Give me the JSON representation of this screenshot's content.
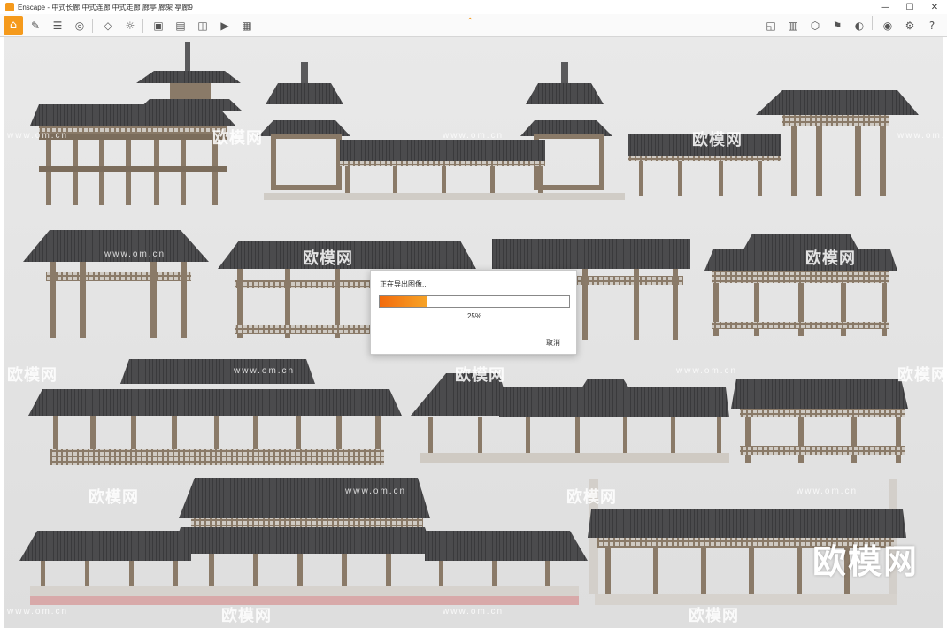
{
  "window": {
    "title": "Enscape - 中式长廊 中式连廊 中式走廊 廊亭 廊架 亭廊9",
    "controls": [
      "—",
      "☐",
      "✕"
    ]
  },
  "toolbar": {
    "left_icons": [
      "home-icon",
      "pen-icon",
      "list-icon",
      "binoculars-icon",
      "cube-icon",
      "sun-icon",
      "export-image-icon",
      "export-batch-icon",
      "export-panorama-icon",
      "export-video-icon",
      "export-exe-icon"
    ],
    "right_icons": [
      "map-icon",
      "library-icon",
      "asset-icon",
      "bookmark-icon",
      "material-icon",
      "vr-icon",
      "settings-icon",
      "help-icon"
    ]
  },
  "watermarks": {
    "brand": "欧模网",
    "url": "www.om.cn",
    "big": "欧模网"
  },
  "export_dialog": {
    "title": "正在导出图像...",
    "progress_label": "25%",
    "progress": 0.25,
    "cancel_label": "取消"
  },
  "colors": {
    "accent": "#f59a1c",
    "progress_start": "#f26a0c",
    "progress_end": "#f7a427",
    "roof": "#4a4a4c",
    "timber": "#8a7a68",
    "base": "#d9d6d2"
  }
}
